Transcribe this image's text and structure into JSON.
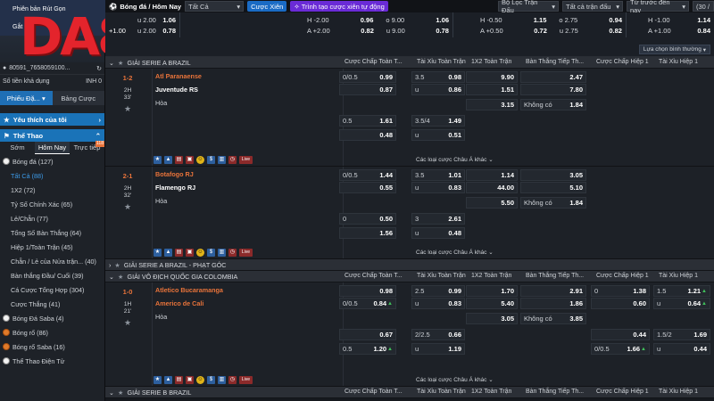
{
  "sidebar": {
    "top_label": "Phiên bản Rút Gọn",
    "top_label2": "Gắt",
    "logo": "DA83",
    "account_id": "80591_7658059100...",
    "balance_label": "Số tiền khả dụng",
    "balance_value": "INH 0",
    "tabs": [
      "Phiếu Đặ...",
      "Bảng Cược"
    ],
    "favorites": "Yêu thích của tôi",
    "sports_header": "Thể Thao",
    "time_tabs": [
      "Sớm",
      "Hôm Nay",
      "Trực tiếp"
    ],
    "live_badge": "118",
    "items": [
      {
        "label": "Bóng đá (127)",
        "kind": "sport"
      },
      {
        "label": "Tất Cả (88)",
        "kind": "sub",
        "selected": true
      },
      {
        "label": "1X2 (72)",
        "kind": "sub"
      },
      {
        "label": "Tỷ Số Chính Xác (65)",
        "kind": "sub"
      },
      {
        "label": "Lẻ/Chẵn (77)",
        "kind": "sub"
      },
      {
        "label": "Tổng Số Bàn Thắng (64)",
        "kind": "sub"
      },
      {
        "label": "Hiệp 1/Toàn Trận (45)",
        "kind": "sub"
      },
      {
        "label": "Chẵn / Lẻ của Nửa trận... (40)",
        "kind": "sub"
      },
      {
        "label": "Bàn thắng Đầu/ Cuối (39)",
        "kind": "sub"
      },
      {
        "label": "Cá Cược Tổng Hợp (304)",
        "kind": "sub"
      },
      {
        "label": "Cược Thắng (41)",
        "kind": "sub"
      },
      {
        "label": "Bóng Đá Saba (4)",
        "kind": "sport"
      },
      {
        "label": "Bóng rổ (86)",
        "kind": "sport-bb"
      },
      {
        "label": "Bóng rổ Saba (16)",
        "kind": "sport-bb"
      },
      {
        "label": "Thể Thao Điện Tử",
        "kind": "sport"
      }
    ]
  },
  "topbar": {
    "crumb": "Bóng đá / Hôm Nay",
    "filter": "Tất Cả",
    "combo": "Cược Xiên",
    "auto_combo": "Trình tạo cược xiên tự động",
    "league_filter": "Bộ Lọc Trận Đấu",
    "all_matches": "Tất cả trận đấu",
    "sort": "Từ trước đến nay",
    "pages": "(30 /"
  },
  "strip": {
    "boxes": [
      {
        "rows": [
          [
            "u 2.00",
            "1.06"
          ],
          [
            "u 2.00",
            "0.78"
          ]
        ],
        "left_extra": "+1.00"
      },
      {
        "rows": [
          [
            "H -2.00",
            "0.96",
            "o 9.00",
            "1.06"
          ],
          [
            "A +2.00",
            "0.82",
            "u 9.00",
            "0.78"
          ]
        ]
      },
      {
        "rows": [
          [
            "H -0.50",
            "1.15",
            "o 2.75",
            "0.94"
          ],
          [
            "A +0.50",
            "0.72",
            "u 2.75",
            "0.82"
          ]
        ]
      },
      {
        "rows": [
          [
            "H -1.00",
            "1.14"
          ],
          [
            "A +1.00",
            "0.84"
          ]
        ]
      }
    ],
    "filter_btn": "Lựa chọn bình thường"
  },
  "headers": {
    "hdp_ft": "Cược Chấp Toàn T...",
    "ou_ft": "Tài Xỉu Toàn Trận",
    "x12_ft": "1X2 Toàn Trận",
    "goal_ft": "Bàn Thắng Tiếp Th...",
    "hdp_h1": "Cược Chấp Hiệp 1",
    "ou_h1": "Tài Xỉu Hiệp 1"
  },
  "leagues": [
    {
      "name": "GIẢI SERIE A BRAZIL"
    },
    {
      "name": "GIẢI SERIE A BRAZIL - PHẠT GÓC"
    },
    {
      "name": "GIẢI VÔ ĐỊCH QUỐC GIA COLOMBIA"
    },
    {
      "name": "GIẢI SERIE B BRAZIL"
    }
  ],
  "matches": [
    {
      "score": "1-2",
      "half": "2H",
      "minute": "33'",
      "home": "Atl Paranaense",
      "away": "Juventude RS",
      "draw": "Hòa",
      "hdp": [
        [
          "0/0.5",
          "0.99"
        ],
        [
          "",
          "0.87"
        ],
        [
          "0.5",
          "1.61"
        ],
        [
          "",
          "0.48"
        ]
      ],
      "ou": [
        [
          "3.5",
          "0.98"
        ],
        [
          "u",
          "0.86"
        ],
        [
          "3.5/4",
          "1.49"
        ],
        [
          "u",
          "0.51"
        ]
      ],
      "x12": [
        "9.90",
        "1.51",
        "3.15"
      ],
      "goal": [
        [
          "",
          "2.47"
        ],
        [
          "",
          "7.80"
        ],
        [
          "Không có",
          "1.84"
        ]
      ],
      "more": "Các loại cược Châu Á khác"
    },
    {
      "score": "2-1",
      "half": "2H",
      "minute": "32'",
      "home": "Botafogo RJ",
      "away": "Flamengo RJ",
      "draw": "Hòa",
      "hdp": [
        [
          "0/0.5",
          "1.44"
        ],
        [
          "",
          "0.55"
        ],
        [
          "0",
          "0.50"
        ],
        [
          "",
          "1.56"
        ]
      ],
      "ou": [
        [
          "3.5",
          "1.01"
        ],
        [
          "u",
          "0.83"
        ],
        [
          "3",
          "2.61"
        ],
        [
          "u",
          "0.48"
        ]
      ],
      "x12": [
        "1.14",
        "44.00",
        "5.50"
      ],
      "goal": [
        [
          "",
          "3.05"
        ],
        [
          "",
          "5.10"
        ],
        [
          "Không có",
          "1.84"
        ]
      ],
      "more": "Các loại cược Châu Á khác"
    },
    {
      "score": "1-0",
      "half": "1H",
      "minute": "21'",
      "home": "Atletico Bucaramanga",
      "away": "Americo de Cali",
      "draw": "Hòa",
      "hdp": [
        [
          "",
          "0.98"
        ],
        [
          "0/0.5",
          "0.84"
        ],
        [
          "",
          "0.67"
        ],
        [
          "0.5",
          "1.20"
        ]
      ],
      "ou": [
        [
          "2.5",
          "0.99"
        ],
        [
          "u",
          "0.83"
        ],
        [
          "2/2.5",
          "0.66"
        ],
        [
          "u",
          "1.19"
        ]
      ],
      "x12": [
        "1.70",
        "5.40",
        "3.05"
      ],
      "goal": [
        [
          "",
          "2.91"
        ],
        [
          "",
          "1.86"
        ],
        [
          "Không có",
          "3.85"
        ]
      ],
      "hdp1": [
        [
          "0",
          "1.38"
        ],
        [
          "",
          "0.60"
        ],
        [
          "",
          "0.44"
        ],
        [
          "0/0.5",
          "1.66"
        ]
      ],
      "ou1": [
        [
          "1.5",
          "1.21"
        ],
        [
          "u",
          "0.64"
        ],
        [
          "1.5/2",
          "1.69"
        ],
        [
          "u",
          "0.44"
        ]
      ],
      "more": "Các loại cược Châu Á khác"
    }
  ],
  "icons": {
    "live_label": "Live"
  }
}
